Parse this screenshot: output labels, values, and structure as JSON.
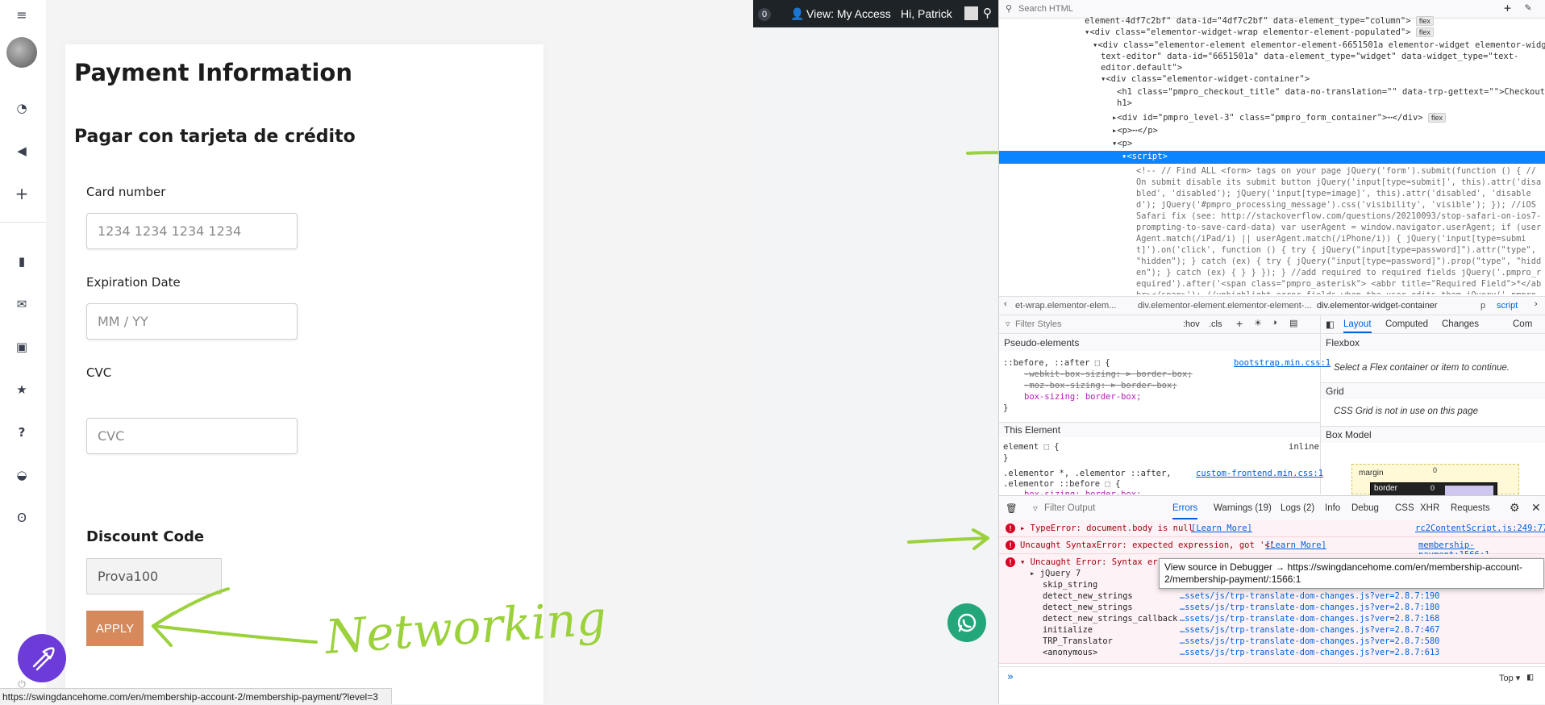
{
  "sidebar": {
    "menu_icon": "hamburger-icon",
    "items": [
      {
        "icon": "dashboard-icon",
        "glyph": "◔"
      },
      {
        "icon": "megaphone-icon",
        "glyph": "📢"
      },
      {
        "icon": "plus-icon",
        "glyph": "+"
      },
      {
        "icon": "book-icon",
        "glyph": "▮"
      },
      {
        "icon": "envelope-icon",
        "glyph": "✉"
      },
      {
        "icon": "id-card-icon",
        "glyph": "▭"
      },
      {
        "icon": "star-icon",
        "glyph": "★"
      },
      {
        "icon": "question-icon",
        "glyph": "?"
      },
      {
        "icon": "basket-icon",
        "glyph": "◒"
      },
      {
        "icon": "medal-icon",
        "glyph": "ʘ"
      }
    ]
  },
  "page": {
    "title": "Payment Information",
    "subtitle": "Pagar con tarjeta de crédito",
    "card_number_label": "Card number",
    "card_number_placeholder": "1234 1234 1234 1234",
    "expiration_label": "Expiration Date",
    "expiration_placeholder": "MM / YY",
    "cvc_label": "CVC",
    "cvc_placeholder": "CVC",
    "discount_label": "Discount Code",
    "discount_value": "Prova100",
    "apply_label": "APPLY",
    "annotation_text": "Networking",
    "accent_color": "#d6895b"
  },
  "admin_bar": {
    "count": "0",
    "view_label": "View: My Access",
    "greeting": "Hi, Patrick"
  },
  "status_bar": {
    "url": "https://swingdancehome.com/en/membership-account-2/membership-payment/?level=3"
  },
  "devtools": {
    "search_placeholder": "Search HTML",
    "tree": [
      {
        "indent": 0,
        "text": "element-4df7c2bf\" data-id=\"4df7c2bf\" data-element_type=\"column\">",
        "badge": "flex"
      },
      {
        "indent": 1,
        "text": "▾<div class=\"elementor-widget-wrap elementor-element-populated\">",
        "badge": "flex"
      },
      {
        "indent": 2,
        "text": "▾<div class=\"elementor-element elementor-element-6651501a elementor-widget elementor-widget-",
        "badge": ""
      },
      {
        "indent": 3,
        "text": "text-editor\" data-id=\"6651501a\" data-element_type=\"widget\" data-widget_type=\"text-",
        "badge": ""
      },
      {
        "indent": 3,
        "text": "editor.default\">",
        "badge": ""
      },
      {
        "indent": 3,
        "text": "▾<div class=\"elementor-widget-container\">",
        "badge": ""
      },
      {
        "indent": 4,
        "text": "<h1 class=\"pmpro_checkout_title\" data-no-translation=\"\" data-trp-gettext=\"\">Checkout</",
        "badge": ""
      },
      {
        "indent": 4,
        "text": "h1>",
        "badge": ""
      },
      {
        "indent": 4,
        "text": "▸<div id=\"pmpro_level-3\" class=\"pmpro_form_container\">⋯</div>",
        "badge": "flex"
      },
      {
        "indent": 4,
        "text": "▸<p>⋯</p>",
        "badge": ""
      },
      {
        "indent": 4,
        "text": "▾<p>",
        "badge": ""
      }
    ],
    "selected_node": "▾<script>",
    "script_content": "<!-- // Find ALL <form> tags on your page jQuery('form').submit(function () { // On submit disable its submit button jQuery('input[type=submit]', this).attr('disabled', 'disabled'); jQuery('input[type=image]', this).attr('disabled', 'disabled'); jQuery('#pmpro_processing_message').css('visibility', 'visible'); }); //iOS Safari fix (see: http://stackoverflow.com/questions/20210093/stop-safari-on-ios7-prompting-to-save-card-data) var userAgent = window.navigator.userAgent; if (userAgent.match(/iPad/i) || userAgent.match(/iPhone/i)) { jQuery('input[type=submit]').on('click', function () { try { jQuery(\"input[type=password]\").attr(\"type\", \"hidden\"); } catch (ex) { try { jQuery(\"input[type=password]\").prop(\"type\", \"hidden\"); } catch (ex) { } } }); } //add required to required fields jQuery('.pmpro_required').after('<span class=\"pmpro_asterisk\"> <abbr title=\"Required Field\">*</abbr></span>'); //unhighlight error fields when the user edits them jQuery('.pmpro_error').on(\"change",
    "breadcrumbs": [
      "et-wrap.elementor-elem...",
      "div.elementor-element.elementor-element-...",
      "div.elementor-widget-container",
      "p",
      "script"
    ],
    "filter_styles": "Filter Styles",
    "pseudo_states": ":hov",
    "cls": ".cls",
    "pseudo_elements_title": "Pseudo-elements",
    "rule1_selector": "::before, ::after ⬚ {",
    "rule1_source": "bootstrap.min.css:1",
    "rule1_props": [
      "-webkit-box-sizing: ⊳ border-box;",
      "-moz-box-sizing: ⊳ border-box;",
      "box-sizing: border-box;"
    ],
    "rule1_close": "}",
    "this_element": "This Element",
    "element_rule": "element ⬚ {",
    "element_rule_close": "}",
    "inline": "inline",
    "rule2_selector": ".elementor *, .elementor ::after,",
    "rule2_selector2": ".elementor ::before ⬚ {",
    "rule2_source": "custom-frontend.min.css:1",
    "rule2_cut": "box-sizing: border-box;",
    "layout_tabs": [
      "Layout",
      "Computed",
      "Changes",
      "Com"
    ],
    "flexbox_title": "Flexbox",
    "flexbox_msg": "Select a Flex container or item to continue.",
    "grid_title": "Grid",
    "grid_msg": "CSS Grid is not in use on this page",
    "boxmodel_title": "Box Model",
    "margin_label": "margin",
    "margin_value": "0",
    "border_label": "border",
    "border_value": "0",
    "console_filter": "Filter Output",
    "console_tabs": [
      "Errors",
      "Warnings (19)",
      "Logs (2)",
      "Info",
      "Debug",
      "CSS",
      "XHR",
      "Requests"
    ],
    "errors": [
      {
        "text": "▸ TypeError: document.body is null",
        "learn": "[Learn More]",
        "source": "rc2ContentScript.js:249:77"
      },
      {
        "text": "Uncaught SyntaxError: expected expression, got '<'",
        "learn": "[Learn More]",
        "source": "membership-payment:1566:1"
      },
      {
        "text": "▾ Uncaught Error: Syntax erro",
        "learn": "",
        "source": ""
      }
    ],
    "jquery_frame": "▸ jQuery 7",
    "stack": [
      {
        "fn": "skip_string",
        "loc": ""
      },
      {
        "fn": "detect_new_strings",
        "loc": "…ssets/js/trp-translate-dom-changes.js?ver=2.8.7:190"
      },
      {
        "fn": "detect_new_strings",
        "loc": "…ssets/js/trp-translate-dom-changes.js?ver=2.8.7:180"
      },
      {
        "fn": "detect_new_strings_callback",
        "loc": "…ssets/js/trp-translate-dom-changes.js?ver=2.8.7:168"
      },
      {
        "fn": "initialize",
        "loc": "…ssets/js/trp-translate-dom-changes.js?ver=2.8.7:467"
      },
      {
        "fn": "TRP_Translator",
        "loc": "…ssets/js/trp-translate-dom-changes.js?ver=2.8.7:580"
      },
      {
        "fn": "<anonymous>",
        "loc": "…ssets/js/trp-translate-dom-changes.js?ver=2.8.7:613"
      }
    ],
    "tooltip": "View source in Debugger → https://swingdancehome.com/en/membership-account-2/membership-payment/:1566:1",
    "console_prompt": "»",
    "context": "Top ▾"
  }
}
